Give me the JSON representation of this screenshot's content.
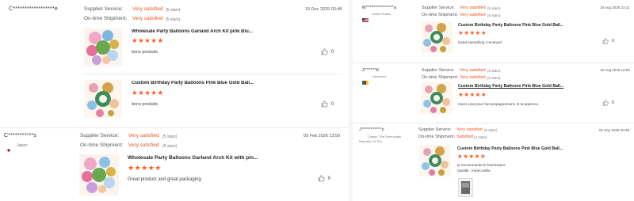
{
  "colors": {
    "accent": "#ff5a1f",
    "satisfied": "#e8551f"
  },
  "labels": {
    "supplier_service": "Supplier Service:",
    "ontime_shipment": "On-time Shipment:"
  },
  "left_panel": {
    "reviews": [
      {
        "reviewer": "C******************e",
        "country": "",
        "flag": "sierra-leone-flag",
        "supplier_service": "Very satisfied",
        "supplier_stars": "(5 stars)",
        "ontime_shipment": "Very satisfied",
        "ontime_stars": "(5 stars)",
        "date": "15 Dec 2025 03:48",
        "products": [
          {
            "title": "Wholesale Party Balloons Garland Arch Kit pink Blu...",
            "stars": "★★★★★",
            "comment": "bons produits",
            "likes": "0"
          },
          {
            "title": "Custom Birthday Party Balloons Pink Blue Gold Ball...",
            "stars": "★★★★★",
            "comment": "bons produits",
            "likes": "0"
          }
        ]
      },
      {
        "reviewer": "C***********s",
        "country": "Japan",
        "flag": "japan-flag",
        "supplier_service": "Very satisfied",
        "supplier_stars": "(5 stars)",
        "ontime_shipment": "Very satisfied",
        "ontime_stars": "(5 stars)",
        "date": "09 Feb 2026 13:50",
        "products": [
          {
            "title": "Wholesale Party Balloons Garland Arch Kit with pin...",
            "stars": "★★★★★",
            "comment": "Great product and great packaging",
            "likes": "0"
          }
        ]
      }
    ]
  },
  "right_panel": {
    "reviews": [
      {
        "reviewer": "M***************a",
        "country": "United States",
        "flag": "us-flag",
        "supplier_service": "Very satisfied",
        "supplier_stars": "(5 stars)",
        "ontime_shipment": "Very satisfied",
        "ontime_stars": "(5 stars)",
        "date": "19 Aug 2025 23:11",
        "products": [
          {
            "title": "Custom Birthday Party Balloons Pink Blue Gold Ball...",
            "stars": "★★★★★",
            "comment": "loved everything I received",
            "likes": "0"
          }
        ]
      },
      {
        "reviewer": "Z******K",
        "country": "Cameroon",
        "flag": "cameroon-flag",
        "supplier_service": "Very satisfied",
        "supplier_stars": "(5 stars)",
        "ontime_shipment": "Very satisfied",
        "ontime_stars": "(5 stars)",
        "date": "16 Aug 2025 10:50",
        "products": [
          {
            "title": "Custom Birthday Party Balloons Pink Blue Gold Ball...",
            "stars": "★★★★★",
            "comment": "merci Lisa pour l'accompagnement, et ta patience.",
            "likes": "0"
          }
        ]
      },
      {
        "reviewer": "J***********s",
        "country": "Congo, The Democratic Republic Of The",
        "flag": "dr-congo-flag",
        "supplier_service": "Very satisfied",
        "supplier_stars": "(5 stars)",
        "ontime_shipment": "Satisfied",
        "ontime_stars": "(4 stars)",
        "date": "02 Sep 2025 00:38",
        "products": [
          {
            "title": "Custom Birthday Party Balloons Pink Blue Gold Ball...",
            "stars": "★★★★★",
            "comment": "je recommande le fournisseur",
            "comment2": "Qualité : impeccable",
            "likes": ""
          }
        ]
      }
    ]
  }
}
